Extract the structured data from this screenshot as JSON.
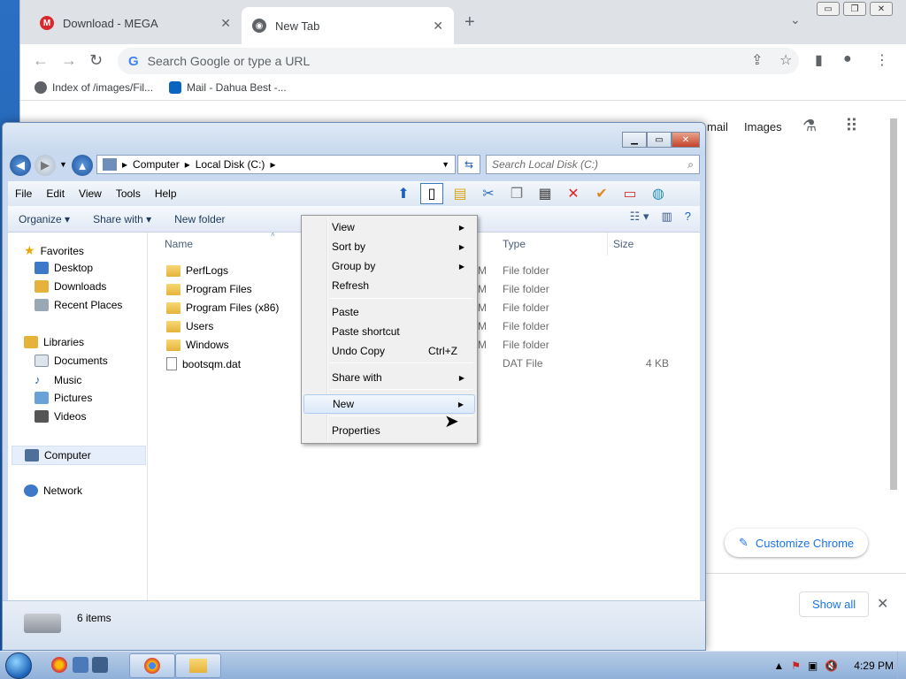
{
  "chrome": {
    "tabs": [
      {
        "title": "Download - MEGA",
        "icon": "mega-icon"
      },
      {
        "title": "New Tab",
        "icon": "chrome-icon"
      }
    ],
    "omnibox_placeholder": "Search Google or type a URL",
    "bookmarks": [
      {
        "label": "Index of /images/Fil...",
        "icon": "globe-icon"
      },
      {
        "label": "Mail - Dahua Best -...",
        "icon": "outlook-icon"
      }
    ],
    "page": {
      "gmail": "mail",
      "images": "Images",
      "customize": "Customize Chrome"
    },
    "download_bar": {
      "show_all": "Show all"
    }
  },
  "explorer": {
    "address": [
      "Computer",
      "Local Disk (C:)"
    ],
    "search_placeholder": "Search Local Disk (C:)",
    "menu": [
      "File",
      "Edit",
      "View",
      "Tools",
      "Help"
    ],
    "commands": {
      "organize": "Organize",
      "share_with": "Share with",
      "new_folder": "New folder"
    },
    "nav": {
      "favorites": "Favorites",
      "favorites_items": [
        "Desktop",
        "Downloads",
        "Recent Places"
      ],
      "libraries": "Libraries",
      "libraries_items": [
        "Documents",
        "Music",
        "Pictures",
        "Videos"
      ],
      "computer": "Computer",
      "network": "Network"
    },
    "columns": {
      "name": "Name",
      "type": "Type",
      "size": "Size"
    },
    "files": [
      {
        "name": "PerfLogs",
        "date_tail": "M",
        "type": "File folder",
        "size": ""
      },
      {
        "name": "Program Files",
        "date_tail": "M",
        "type": "File folder",
        "size": ""
      },
      {
        "name": "Program Files (x86)",
        "date_tail": "M",
        "type": "File folder",
        "size": ""
      },
      {
        "name": "Users",
        "date_tail": "M",
        "type": "File folder",
        "size": ""
      },
      {
        "name": "Windows",
        "date_tail": "M",
        "type": "File folder",
        "size": ""
      },
      {
        "name": "bootsqm.dat",
        "date_tail": "",
        "type": "DAT File",
        "size": "4 KB"
      }
    ],
    "status": "6 items"
  },
  "context_menu": {
    "items": [
      {
        "label": "View",
        "submenu": true
      },
      {
        "label": "Sort by",
        "submenu": true
      },
      {
        "label": "Group by",
        "submenu": true
      },
      {
        "label": "Refresh"
      },
      {
        "label": "Paste"
      },
      {
        "label": "Paste shortcut"
      },
      {
        "label": "Undo Copy",
        "shortcut": "Ctrl+Z"
      },
      {
        "label": "Share with",
        "submenu": true
      },
      {
        "label": "New",
        "submenu": true,
        "highlighted": true
      },
      {
        "label": "Properties"
      }
    ]
  },
  "taskbar": {
    "time": "4:29 PM"
  },
  "colors": {
    "accent": "#1a73e8",
    "explorer_frame": "#c9daf0",
    "taskbar": "#8fb0da"
  }
}
